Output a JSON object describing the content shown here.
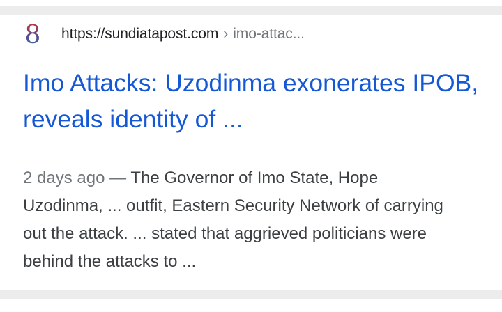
{
  "result": {
    "favicon_letter": "8",
    "url_domain": "https://sundiatapost.com",
    "url_separator": "›",
    "url_path": "imo-attac...",
    "title": "Imo Attacks: Uzodinma exonerates IPOB, reveals identity of ...",
    "date": "2 days ago",
    "dash": "—",
    "snippet": "The Governor of Imo State, Hope Uzodinma, ... outfit, Eastern Security Network of carrying out the attack. ... stated that aggrieved politicians were behind the attacks to ..."
  },
  "colors": {
    "link": "#1558d6",
    "text": "#3c4043",
    "secondary": "#70757a",
    "background": "#ececec"
  },
  "icons": {
    "favicon": "site-favicon-icon"
  }
}
